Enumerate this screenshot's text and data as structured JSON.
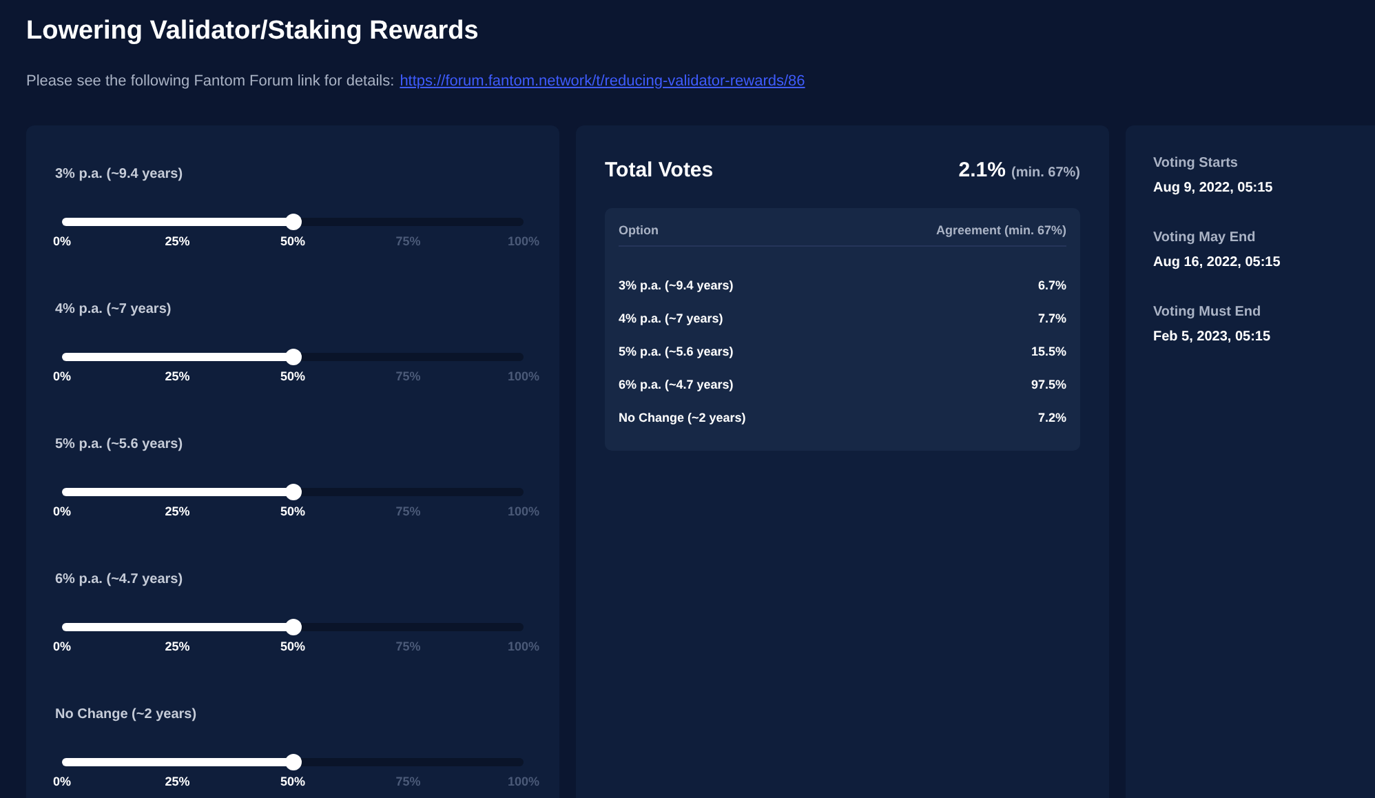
{
  "title": "Lowering Validator/Staking Rewards",
  "intro": {
    "text": "Please see the following Fantom Forum link for details:",
    "link": "https://forum.fantom.network/t/reducing-validator-rewards/86"
  },
  "sliders": [
    {
      "label": "3% p.a. (~9.4 years)",
      "level": 0.5,
      "ticks": [
        "0%",
        "25%",
        "50%",
        "75%",
        "100%"
      ]
    },
    {
      "label": "4% p.a. (~7 years)",
      "level": 0.5,
      "ticks": [
        "0%",
        "25%",
        "50%",
        "75%",
        "100%"
      ]
    },
    {
      "label": "5% p.a. (~5.6 years)",
      "level": 0.5,
      "ticks": [
        "0%",
        "25%",
        "50%",
        "75%",
        "100%"
      ]
    },
    {
      "label": "6% p.a. (~4.7 years)",
      "level": 0.5,
      "ticks": [
        "0%",
        "25%",
        "50%",
        "75%",
        "100%"
      ]
    },
    {
      "label": "No Change (~2 years)",
      "level": 0.5,
      "ticks": [
        "0%",
        "25%",
        "50%",
        "75%",
        "100%"
      ]
    }
  ],
  "total_votes": {
    "title": "Total Votes",
    "value": "2.1%",
    "minimum": "(min. 67%)"
  },
  "table": {
    "columns": [
      "Option",
      "Agreement (min. 67%)"
    ],
    "rows": [
      [
        "3% p.a. (~9.4 years)",
        "6.7%"
      ],
      [
        "4% p.a. (~7 years)",
        "7.7%"
      ],
      [
        "5% p.a. (~5.6 years)",
        "15.5%"
      ],
      [
        "6% p.a. (~4.7 years)",
        "97.5%"
      ],
      [
        "No Change (~2 years)",
        "7.2%"
      ]
    ]
  },
  "schedule": [
    {
      "label": "Voting Starts",
      "value": "Aug 9, 2022, 05:15"
    },
    {
      "label": "Voting May End",
      "value": "Aug 16, 2022, 05:15"
    },
    {
      "label": "Voting Must End",
      "value": "Feb 5, 2023, 05:15"
    }
  ]
}
